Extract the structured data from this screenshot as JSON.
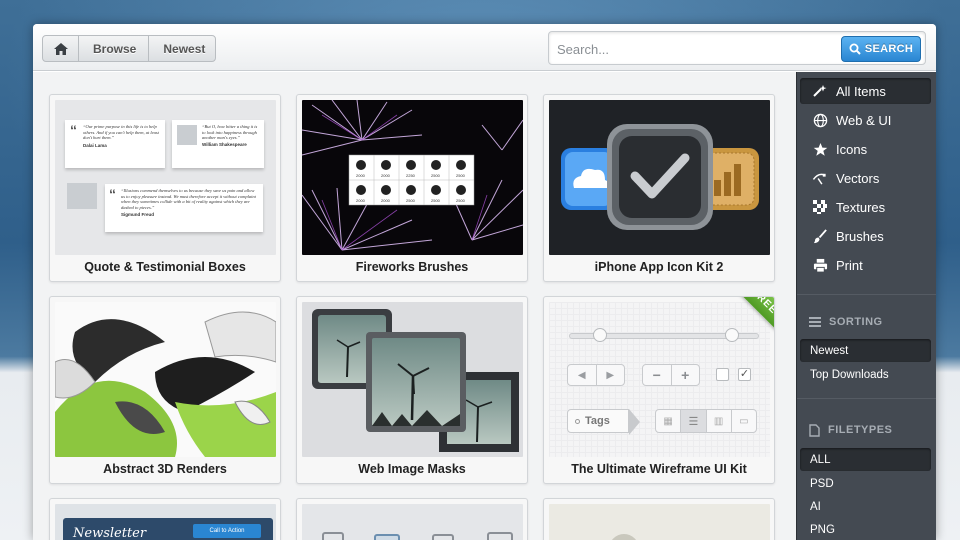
{
  "breadcrumb": {
    "items": [
      "Browse",
      "Newest"
    ]
  },
  "search": {
    "placeholder": "Search...",
    "button_label": "SEARCH"
  },
  "cards": [
    {
      "title": "Quote & Testimonial Boxes"
    },
    {
      "title": "Fireworks Brushes"
    },
    {
      "title": "iPhone App Icon Kit 2"
    },
    {
      "title": "Abstract 3D Renders"
    },
    {
      "title": "Web Image Masks"
    },
    {
      "title": "The Ultimate Wireframe UI Kit"
    }
  ],
  "thumb_text": {
    "quote1": "“Our prime purpose in this life is to help others. And if you can't help them, at least don't hurt them.”",
    "quote1_author": "Dalai Lama",
    "quote2": "“But O, how bitter a thing it is to look into happiness through another man's eyes.”",
    "quote2_author": "William Shakespeare",
    "quote3": "“Illusions commend themselves to us because they save us pain and allow us to enjoy pleasure instead. We must therefore accept it without complaint when they sometimes collide with a bit of reality against which they are dashed to pieces.”",
    "quote3_author": "Sigmund Freud",
    "brush_numbers": [
      "2000",
      "2000",
      "2250",
      "2500",
      "2500",
      "2000",
      "2000",
      "2500",
      "2500",
      "2500"
    ],
    "ribbon": "FREE",
    "tags_label": "Tags",
    "newsletter": "Newsletter",
    "call_to_action": "Call to Action"
  },
  "sidebar": {
    "categories": [
      {
        "label": "All Items",
        "icon": "sparkle-icon",
        "active": true
      },
      {
        "label": "Web & UI",
        "icon": "globe-icon",
        "active": false
      },
      {
        "label": "Icons",
        "icon": "star-icon",
        "active": false
      },
      {
        "label": "Vectors",
        "icon": "pen-tool-icon",
        "active": false
      },
      {
        "label": "Textures",
        "icon": "checker-icon",
        "active": false
      },
      {
        "label": "Brushes",
        "icon": "brush-icon",
        "active": false
      },
      {
        "label": "Print",
        "icon": "printer-icon",
        "active": false
      }
    ],
    "sorting": {
      "heading": "SORTING",
      "options": [
        "Newest",
        "Top Downloads"
      ],
      "selected": "Newest"
    },
    "filetypes": {
      "heading": "FILETYPES",
      "options": [
        "ALL",
        "PSD",
        "AI",
        "PNG"
      ],
      "selected": "ALL"
    }
  },
  "colors": {
    "accent_blue": "#2a86d2",
    "sidebar_bg": "#444a52",
    "ribbon_green": "#5fae2e"
  }
}
